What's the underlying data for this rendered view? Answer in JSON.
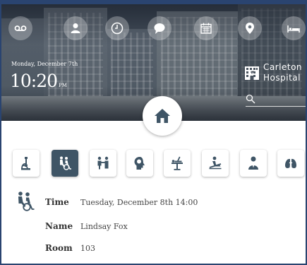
{
  "top_icons": [
    "voicemail-icon",
    "person-icon",
    "clock-icon",
    "chat-icon",
    "calendar-icon",
    "location-pin-icon",
    "bed-icon"
  ],
  "header": {
    "date": "Monday, December 7th",
    "time": "10:20",
    "ampm": "PM",
    "hospital_line1": "Carleton",
    "hospital_line2": "Hospital"
  },
  "categories": [
    {
      "icon": "microscope-icon",
      "active": false
    },
    {
      "icon": "wheelchair-assist-icon",
      "active": true
    },
    {
      "icon": "consult-icon",
      "active": false
    },
    {
      "icon": "head-brain-icon",
      "active": false
    },
    {
      "icon": "surgery-icon",
      "active": false
    },
    {
      "icon": "patient-rest-icon",
      "active": false
    },
    {
      "icon": "doctor-icon",
      "active": false
    },
    {
      "icon": "lungs-icon",
      "active": false
    }
  ],
  "colors": {
    "accent": "#3f5566",
    "frame": "#2a4470",
    "icon": "#3f5566"
  },
  "details": {
    "time_label": "Time",
    "time_value": "Tuesday, December 8th 14:00",
    "name_label": "Name",
    "name_value": "Lindsay Fox",
    "room_label": "Room",
    "room_value": "103"
  }
}
